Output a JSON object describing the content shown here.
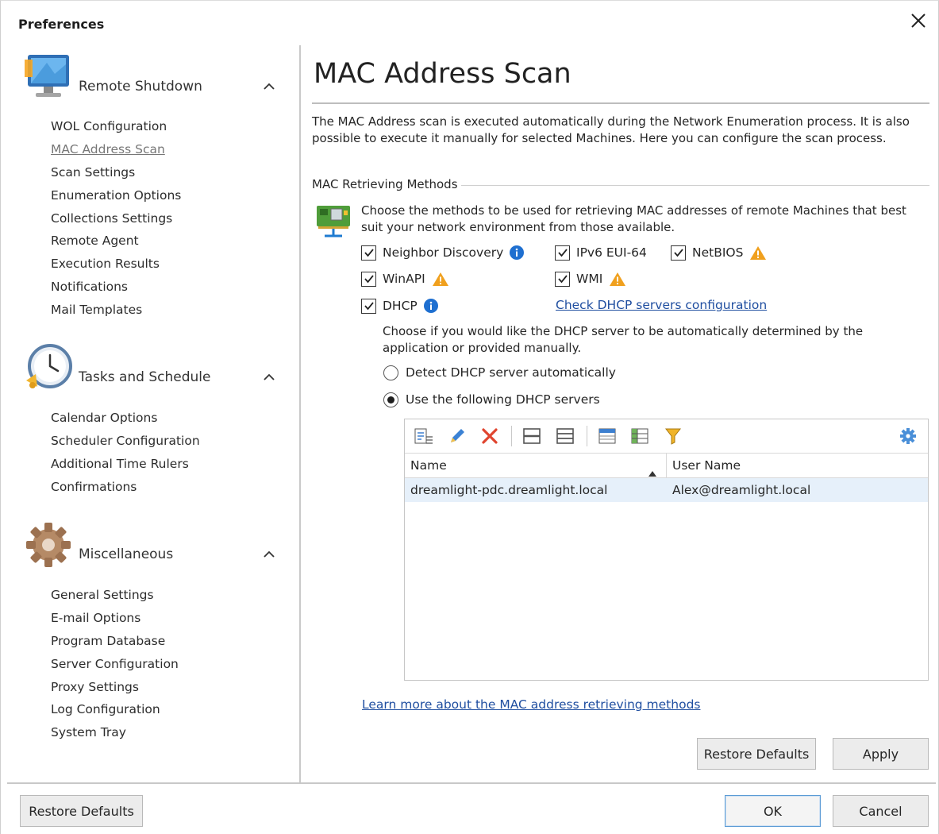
{
  "window": {
    "title": "Preferences"
  },
  "sidebar": {
    "groups": [
      {
        "title": "Remote Shutdown",
        "items": [
          "WOL Configuration",
          "MAC Address Scan",
          "Scan Settings",
          "Enumeration Options",
          "Collections Settings",
          "Remote Agent",
          "Execution Results",
          "Notifications",
          "Mail Templates"
        ]
      },
      {
        "title": "Tasks and Schedule",
        "items": [
          "Calendar Options",
          "Scheduler Configuration",
          "Additional Time Rulers",
          "Confirmations"
        ]
      },
      {
        "title": "Miscellaneous",
        "items": [
          "General Settings",
          "E-mail Options",
          "Program Database",
          "Server Configuration",
          "Proxy Settings",
          "Log Configuration",
          "System Tray"
        ]
      }
    ]
  },
  "main": {
    "title": "MAC Address Scan",
    "description": "The MAC Address scan is executed automatically during the Network Enumeration process. It is also possible to execute it manually for selected Machines. Here you can configure the scan process.",
    "section_label": "MAC Retrieving Methods",
    "section_desc": "Choose the methods to be used for retrieving MAC addresses of remote Machines that best suit your network environment from those available.",
    "methods": {
      "neighbor_discovery": "Neighbor Discovery",
      "ipv6_eui64": "IPv6 EUI-64",
      "netbios": "NetBIOS",
      "winapi": "WinAPI",
      "wmi": "WMI",
      "dhcp": "DHCP"
    },
    "dhcp_link": "Check DHCP servers configuration",
    "dhcp_desc": "Choose if you would like the DHCP server to be automatically determined by the application or provided manually.",
    "radio_auto": "Detect DHCP server automatically",
    "radio_manual": "Use the following DHCP servers",
    "grid": {
      "columns": [
        "Name",
        "User Name"
      ],
      "rows": [
        {
          "name": "dreamlight-pdc.dreamlight.local",
          "user": "Alex@dreamlight.local"
        }
      ]
    },
    "learn_more": "Learn more about the MAC address retrieving methods",
    "restore_defaults": "Restore Defaults",
    "apply": "Apply"
  },
  "footer": {
    "restore_defaults": "Restore Defaults",
    "ok": "OK",
    "cancel": "Cancel"
  },
  "colors": {
    "link": "#1f4ea0",
    "info": "#1e6fd0",
    "warning": "#f0a01e",
    "selection": "#e6f0fa"
  }
}
